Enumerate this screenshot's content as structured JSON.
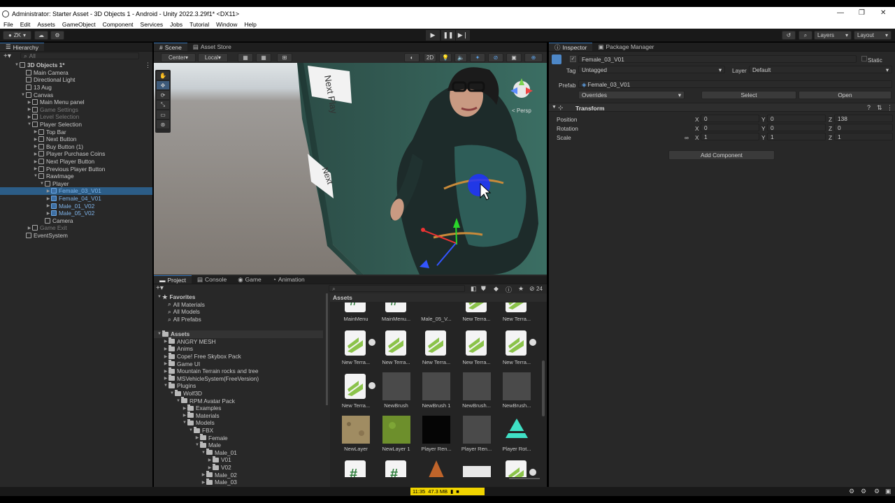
{
  "window": {
    "title": "Administrator: Starter Asset - 3D Objects 1 - Android - Unity 2022.3.29f1* <DX11>"
  },
  "menu": [
    "File",
    "Edit",
    "Assets",
    "GameObject",
    "Component",
    "Services",
    "Jobs",
    "Tutorial",
    "Window",
    "Help"
  ],
  "toolbar": {
    "account": "ZK",
    "layers": "Layers",
    "layout": "Layout"
  },
  "hierarchy": {
    "tab": "Hierarchy",
    "search_placeholder": "All",
    "items": [
      {
        "label": "3D Objects 1*",
        "indent": 0,
        "style": "scene"
      },
      {
        "label": "Main Camera",
        "indent": 1,
        "style": "normal"
      },
      {
        "label": "Directional Light",
        "indent": 1,
        "style": "normal"
      },
      {
        "label": "13 Aug",
        "indent": 1,
        "style": "normal"
      },
      {
        "label": "Canvas",
        "indent": 1,
        "style": "normal"
      },
      {
        "label": "Main Menu panel",
        "indent": 2,
        "style": "normal"
      },
      {
        "label": "Game Settings",
        "indent": 2,
        "style": "dim"
      },
      {
        "label": "Level Selection",
        "indent": 2,
        "style": "dim"
      },
      {
        "label": "Player Selection",
        "indent": 2,
        "style": "normal"
      },
      {
        "label": "Top Bar",
        "indent": 3,
        "style": "normal"
      },
      {
        "label": "Next Button",
        "indent": 3,
        "style": "normal"
      },
      {
        "label": "Buy Button (1)",
        "indent": 3,
        "style": "normal"
      },
      {
        "label": "Player Purchase Coins",
        "indent": 3,
        "style": "normal"
      },
      {
        "label": "Next Player Button",
        "indent": 3,
        "style": "normal"
      },
      {
        "label": "Previous Player Button",
        "indent": 3,
        "style": "normal"
      },
      {
        "label": "RawImage",
        "indent": 3,
        "style": "normal"
      },
      {
        "label": "Player",
        "indent": 4,
        "style": "normal"
      },
      {
        "label": "Female_03_V01",
        "indent": 5,
        "style": "selected"
      },
      {
        "label": "Female_04_V01",
        "indent": 5,
        "style": "blue"
      },
      {
        "label": "Male_01_V02",
        "indent": 5,
        "style": "blue"
      },
      {
        "label": "Male_05_V02",
        "indent": 5,
        "style": "blue"
      },
      {
        "label": "Camera",
        "indent": 4,
        "style": "normal"
      },
      {
        "label": "Game Exit",
        "indent": 2,
        "style": "dim"
      },
      {
        "label": "EventSystem",
        "indent": 1,
        "style": "normal"
      }
    ]
  },
  "scene": {
    "tabs": [
      "Scene",
      "Asset Store"
    ],
    "pivot": "Center",
    "space": "Local",
    "mode_2d": "2D",
    "persp_label": "< Persp",
    "sign_text_1": "Next Play",
    "sign_text_2": "Next"
  },
  "inspector": {
    "tabs": [
      "Inspector",
      "Package Manager"
    ],
    "object_name": "Female_03_V01",
    "static_label": "Static",
    "tag_label": "Tag",
    "tag_value": "Untagged",
    "layer_label": "Layer",
    "layer_value": "Default",
    "prefab_label": "Prefab",
    "prefab_value": "Female_03_V01",
    "overrides": "Overrides",
    "select": "Select",
    "open": "Open",
    "transform_title": "Transform",
    "position_label": "Position",
    "rotation_label": "Rotation",
    "scale_label": "Scale",
    "position": {
      "x": "0",
      "y": "0",
      "z": "138"
    },
    "rotation": {
      "x": "0",
      "y": "0",
      "z": "0"
    },
    "scale": {
      "x": "1",
      "y": "1",
      "z": "1"
    },
    "add_component": "Add Component"
  },
  "project": {
    "tabs": [
      "Project",
      "Console",
      "Game",
      "Animation"
    ],
    "hidden_count": "24",
    "favorites": {
      "title": "Favorites",
      "items": [
        "All Materials",
        "All Models",
        "All Prefabs"
      ]
    },
    "assets_tree": [
      {
        "label": "Assets",
        "indent": 0,
        "open": true,
        "bold": true
      },
      {
        "label": "ANGRY MESH",
        "indent": 1
      },
      {
        "label": "Anims",
        "indent": 1
      },
      {
        "label": "Cope! Free Skybox Pack",
        "indent": 1
      },
      {
        "label": "Game UI",
        "indent": 1
      },
      {
        "label": "Mountain Terrain rocks and tree",
        "indent": 1
      },
      {
        "label": "MSVehicleSystem(FreeVersion)",
        "indent": 1
      },
      {
        "label": "Plugins",
        "indent": 1,
        "open": true
      },
      {
        "label": "Wolf3D",
        "indent": 2,
        "open": true
      },
      {
        "label": "RPM Avatar Pack",
        "indent": 3,
        "open": true
      },
      {
        "label": "Examples",
        "indent": 4
      },
      {
        "label": "Materials",
        "indent": 4
      },
      {
        "label": "Models",
        "indent": 4,
        "open": true
      },
      {
        "label": "FBX",
        "indent": 5,
        "open": true
      },
      {
        "label": "Female",
        "indent": 6
      },
      {
        "label": "Male",
        "indent": 6,
        "open": true
      },
      {
        "label": "Male_01",
        "indent": 7,
        "open": true
      },
      {
        "label": "V01",
        "indent": 8
      },
      {
        "label": "V02",
        "indent": 8
      },
      {
        "label": "Male_02",
        "indent": 7
      },
      {
        "label": "Male_03",
        "indent": 7
      }
    ],
    "breadcrumb": "Assets",
    "grid": [
      {
        "name": "MainMenu",
        "kind": "script"
      },
      {
        "name": "MainMenu...",
        "kind": "script"
      },
      {
        "name": "Male_05_V...",
        "kind": "model"
      },
      {
        "name": "New Terra...",
        "kind": "terrain"
      },
      {
        "name": "New Terra...",
        "kind": "terrain"
      },
      {
        "name": "New Terra...",
        "kind": "terrain-play"
      },
      {
        "name": "New Terra...",
        "kind": "terrain"
      },
      {
        "name": "New Terra...",
        "kind": "terrain"
      },
      {
        "name": "New Terra...",
        "kind": "terrain"
      },
      {
        "name": "New Terra...",
        "kind": "terrain-play"
      },
      {
        "name": "New Terra...",
        "kind": "terrain-play"
      },
      {
        "name": "NewBrush",
        "kind": "brush"
      },
      {
        "name": "NewBrush 1",
        "kind": "brush"
      },
      {
        "name": "NewBrush...",
        "kind": "brush"
      },
      {
        "name": "NewBrush...",
        "kind": "brush"
      },
      {
        "name": "NewLayer",
        "kind": "dirt"
      },
      {
        "name": "NewLayer 1",
        "kind": "grass"
      },
      {
        "name": "Player Ren...",
        "kind": "black"
      },
      {
        "name": "Player Ren...",
        "kind": "brush"
      },
      {
        "name": "Player Rot...",
        "kind": "anim"
      },
      {
        "name": "",
        "kind": "script"
      },
      {
        "name": "",
        "kind": "script"
      },
      {
        "name": "",
        "kind": "cone"
      },
      {
        "name": "",
        "kind": "white"
      },
      {
        "name": "",
        "kind": "terrain-play"
      }
    ]
  },
  "status": {
    "time": "11:35",
    "memory": "47.3 MB"
  },
  "colors": {
    "accent": "#3a79bb",
    "selection": "#2c5d87",
    "terrain_green": "#8bc34a",
    "status_yellow": "#f0d400"
  }
}
